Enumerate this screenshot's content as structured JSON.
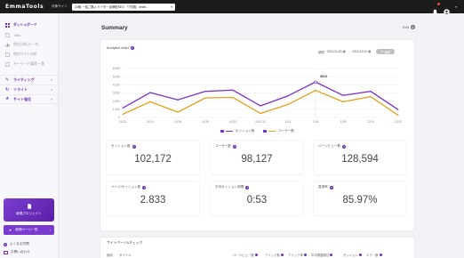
{
  "app": {
    "logo": "EmmaTools",
    "target_site_label": "対象サイト",
    "target_site_value": "22個 一括ご購入ライター自律型SEO 「7日間」news..."
  },
  "sidebar": {
    "items": [
      {
        "label": "ダッシュボード",
        "icon": "dashboard-icon",
        "active": true
      },
      {
        "label": "Tobu",
        "icon": "document-icon"
      },
      {
        "label": "他社分析(データ)",
        "icon": "analytics-icon"
      },
      {
        "label": "他社サイト分析",
        "icon": "document-icon"
      },
      {
        "label": "キーワード管理 一覧",
        "icon": "document-icon"
      }
    ],
    "groups": [
      {
        "label": "ライティング",
        "icon": "pencil-icon"
      },
      {
        "label": "リライト",
        "icon": "refresh-icon"
      },
      {
        "label": "サイト強化",
        "icon": "star-icon"
      }
    ],
    "new_project_label": "新規プロジェクト",
    "add_page_label": "新規ページ一覧",
    "faq_label": "よくある質問",
    "support_label": "お問い合わせ"
  },
  "main": {
    "title": "Summary",
    "edit_label": "Edit",
    "chart_title": "Analytics chart",
    "period_label": "期間",
    "date_from": "2021/11/20",
    "date_to": "2021/12/12",
    "apply_label": "適用",
    "metrics": [
      {
        "label": "セッション数",
        "value": "102,172"
      },
      {
        "label": "ユーザー数",
        "value": "98,127"
      },
      {
        "label": "ページビュー数",
        "value": "128,594"
      },
      {
        "label": "ページ/セッション数",
        "value": "2.833"
      },
      {
        "label": "平均セッション時間",
        "value": "0:53"
      },
      {
        "label": "直帰率",
        "value": "85.97%"
      }
    ],
    "table_title": "サイトページ&チェック",
    "table_headers": [
      "使用",
      "タイトル",
      "ページビュー数",
      "クリック数",
      "クリック率",
      "平均掲載順位",
      "セッション",
      "エラー数"
    ]
  },
  "colors": {
    "brand": "#6b2fba",
    "series_sessions": "#7a32c8",
    "series_users": "#e3a21a"
  },
  "chart_data": {
    "type": "line",
    "title": "",
    "x": [
      "11/22",
      "11/24",
      "11/26",
      "11/28",
      "11/30",
      "2021/12",
      "12/4",
      "12/6",
      "12/8",
      "12/10",
      "12/12"
    ],
    "ylim": [
      0,
      6000
    ],
    "yticks": [
      "0",
      "1,000",
      "2,000",
      "3,000",
      "4,000",
      "5,000",
      "6,000"
    ],
    "series": [
      {
        "name": "セッション数",
        "values": [
          1150,
          3050,
          2150,
          3200,
          3350,
          1420,
          2650,
          4350,
          2700,
          3200,
          950
        ]
      },
      {
        "name": "ユーザー数",
        "values": [
          380,
          1920,
          650,
          2400,
          2450,
          490,
          1590,
          3320,
          1920,
          2550,
          260
        ]
      }
    ],
    "annotation": "3011",
    "legend": "bottom"
  }
}
